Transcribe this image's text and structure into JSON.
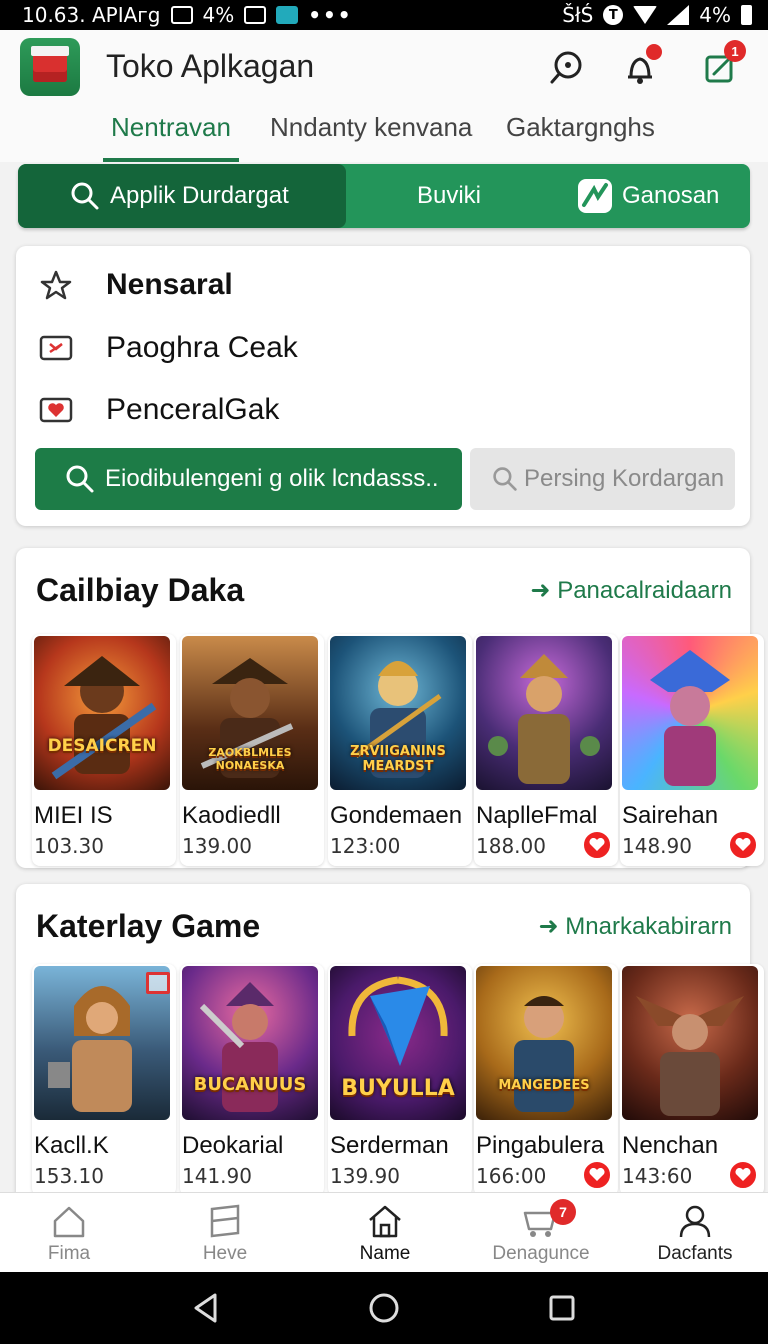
{
  "status_bar": {
    "time": "10.63. APIAгg",
    "battery_left": "4%",
    "network": "ŠłŚ",
    "battery_right": "4%"
  },
  "header": {
    "title": "Toko Aplkagan",
    "notification_count": "1"
  },
  "top_tabs": [
    {
      "label": "Nentravan",
      "active": true
    },
    {
      "label": "Nndanty kenvana",
      "active": false
    },
    {
      "label": "Gaktargnghs",
      "active": false
    }
  ],
  "segments": [
    {
      "label": "Applik Durdargat",
      "icon": "search-icon",
      "active": true
    },
    {
      "label": "Buviki",
      "icon": "",
      "active": false
    },
    {
      "label": "Ganosan",
      "icon": "game-icon",
      "active": false
    }
  ],
  "menu": {
    "items": [
      {
        "label": "Nensaral",
        "icon": "star-outline-icon"
      },
      {
        "label": "Paoghra Ceak",
        "icon": "mail-icon"
      },
      {
        "label": "PenceralGak",
        "icon": "heart-icon"
      }
    ],
    "primary_button": "Eiodibulengeni g olik lcndasss..",
    "secondary_button": "Persing Kordargan"
  },
  "section1": {
    "title": "Cailbiay Daka",
    "link": "Panacalraidaarn",
    "items": [
      {
        "name": "MIEI IS",
        "price": "103.30",
        "art_text": "DESAICREN",
        "badge": false
      },
      {
        "name": "Kaodiedll",
        "price": "139.00",
        "art_text": "ZAOKBLMLES NONAESKA",
        "badge": false
      },
      {
        "name": "Gondemaen",
        "price": "123:00",
        "art_text": "ZRVIIGANINS MEARDST",
        "badge": false
      },
      {
        "name": "NaplleFmal",
        "price": "188.00",
        "art_text": "",
        "badge": true
      },
      {
        "name": "Sairehan",
        "price": "148.90",
        "art_text": "",
        "badge": true
      }
    ]
  },
  "section2": {
    "title": "Katerlay Game",
    "link": "Mnarkakabirarn",
    "items": [
      {
        "name": "Kacll.K",
        "price": "153.10",
        "art_text": "",
        "badge": false,
        "gift": true
      },
      {
        "name": "Deokarial",
        "price": "141.90",
        "art_text": "BUCANUUS",
        "badge": false
      },
      {
        "name": "Serderman",
        "price": "139.90",
        "art_text": "BUYULLA",
        "badge": false
      },
      {
        "name": "Pingabulera",
        "price": "166:00",
        "art_text": "MANGEDEES",
        "badge": true
      },
      {
        "name": "Nenchan",
        "price": "143:60",
        "art_text": "",
        "badge": true
      }
    ]
  },
  "bottom_nav": [
    {
      "label": "Fima",
      "icon": "home-icon",
      "active": false
    },
    {
      "label": "Heve",
      "icon": "book-icon",
      "active": false
    },
    {
      "label": "Name",
      "icon": "house-icon",
      "active": true
    },
    {
      "label": "Denagunce",
      "icon": "cart-icon",
      "active": false,
      "badge": "7"
    },
    {
      "label": "Dacfants",
      "icon": "user-icon",
      "active": false
    }
  ],
  "colors": {
    "brand_green": "#1f7a4a",
    "segment_green": "#23955a",
    "badge_red": "#e02a2a"
  }
}
